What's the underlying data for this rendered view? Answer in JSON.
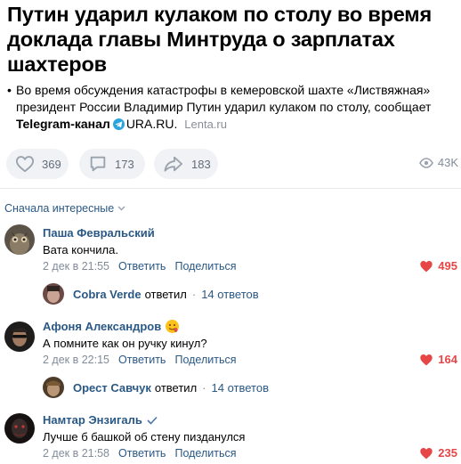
{
  "article": {
    "headline": "Путин ударил кулаком по столу во время доклада главы Минтруда о зарплатах шахтеров",
    "lead_text": "Во время обсуждения катастрофы в кемеровской шахте «Листвяжная» президент России Владимир Путин ударил кулаком по столу, сообщает",
    "channel": "Telegram-канал",
    "channel_name": "URA.RU.",
    "source": "Lenta.ru"
  },
  "actions": {
    "likes": "369",
    "comments": "173",
    "shares": "183",
    "views": "43K"
  },
  "sort_label": "Сначала интересные",
  "comments": [
    {
      "author": "Паша Февральский",
      "text": "Вата кончила.",
      "date": "2 дек в 21:55",
      "reply_label": "Ответить",
      "share_label": "Поделиться",
      "likes": "495",
      "reply": {
        "author": "Cobra Verde",
        "verb": "ответил",
        "count": "14 ответов"
      }
    },
    {
      "author": "Афоня Александров",
      "badge": "emoji",
      "text": "А помните как он ручку кинул?",
      "date": "2 дек в 22:15",
      "reply_label": "Ответить",
      "share_label": "Поделиться",
      "likes": "164",
      "reply": {
        "author": "Орест Савчук",
        "verb": "ответил",
        "count": "14 ответов"
      }
    },
    {
      "author": "Намтар Энзигаль",
      "badge": "verified",
      "text": "Лучше б башкой об стену пизданулся",
      "date": "2 дек в 21:58",
      "reply_label": "Ответить",
      "share_label": "Поделиться",
      "likes": "235"
    }
  ],
  "colors": {
    "link": "#2a5885",
    "like": "#e64646",
    "pill_bg": "#f0f2f5",
    "muted": "#818c99"
  }
}
